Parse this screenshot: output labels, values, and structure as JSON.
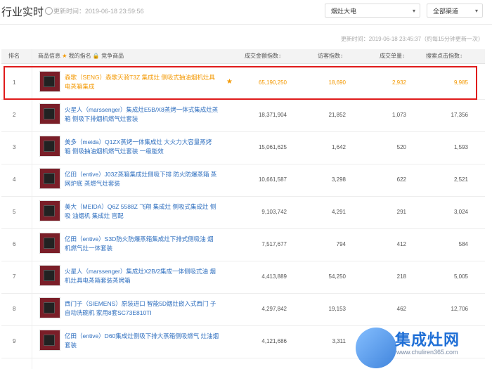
{
  "header": {
    "title": "行业实时",
    "updated_label": "更新时间：2019-06-18 23:59:56",
    "select_category": "烟灶大电",
    "select_channel": "全部渠道",
    "sub_info": "更新时间：2019-06-18 23:45:37（约每15分钟更新一次）"
  },
  "table": {
    "columns": {
      "rank": "排名",
      "goods": "商品信息",
      "goods_star": "★",
      "goods_fav": "我的指名",
      "goods_lock": "🔒",
      "goods_comp": "竞争商品",
      "sales_index": "成交金额指数",
      "visit_index": "访客指数",
      "unit_price": "成交单量",
      "search_index": "搜索点击指数",
      "sort_arrow": "↕"
    },
    "rows": [
      {
        "rank": "1",
        "name": "森歌（SENG）森歌天骑T3Z 集成灶 侧吸式抽油烟机灶具 电蒸箱集成",
        "sales": "65,190,250",
        "visits": "18,690",
        "units": "2,932",
        "search": "9,985",
        "fav": "★"
      },
      {
        "rank": "2",
        "name": "火星人（marssenger）集成灶E5B/X8蒸烤一体式集成灶蒸箱 侧吸下排烟机燃气灶套装",
        "sales": "18,371,904",
        "visits": "21,852",
        "units": "1,073",
        "search": "17,356"
      },
      {
        "rank": "3",
        "name": "美多（meida）Q1ZX蒸烤一体集成灶 大火力大容量蒸烤 箱 侧吸抽油烟机燃气灶套装 一级能效",
        "sales": "15,061,625",
        "visits": "1,642",
        "units": "520",
        "search": "1,593"
      },
      {
        "rank": "4",
        "name": "亿田（entive）J03Z蒸箱集成灶侧吸下排 防火防爆蒸箱 蒸网炉底 蒸燃气灶套装",
        "sales": "10,661,587",
        "visits": "3,298",
        "units": "622",
        "search": "2,521"
      },
      {
        "rank": "5",
        "name": "美大（MEIDA）Q6Z 5588Z 飞翔 集成灶 侧吸式集成灶 侧吸 油烟机 集成灶 官配",
        "sales": "9,103,742",
        "visits": "4,291",
        "units": "291",
        "search": "3,024"
      },
      {
        "rank": "6",
        "name": "亿田（entive）S3D防火防爆蒸箱集成灶下排式侧吸油 烟机燃气灶一体套装",
        "sales": "7,517,677",
        "visits": "794",
        "units": "412",
        "search": "584"
      },
      {
        "rank": "7",
        "name": "火星人（marssenger）集成灶X2B/2集成一体侧吸式油 烟机灶具电蒸箱套装蒸烤箱",
        "sales": "4,413,889",
        "visits": "54,250",
        "units": "218",
        "search": "5,005"
      },
      {
        "rank": "8",
        "name": "西门子（SIEMENS）原装进口 智能5D烟灶嵌入式西门 子自动洗碗机 家用8套SC73E810TI",
        "sales": "4,297,842",
        "visits": "19,153",
        "units": "462",
        "search": "12,706"
      },
      {
        "rank": "9",
        "name": "亿田（entive）D60集成灶侧吸下排大蒸箱侧吸燃气 灶油烟套装",
        "sales": "4,121,686",
        "visits": "3,311",
        "units": "",
        "search": ""
      }
    ]
  },
  "watermark": {
    "brand": "集成灶网",
    "url": "www.chuliren365.com",
    "color": "#1f6fd6"
  },
  "colors": {
    "highlight_border": "#e01b1b",
    "accent_orange": "#f39800",
    "link_blue": "#2f6fbf"
  }
}
